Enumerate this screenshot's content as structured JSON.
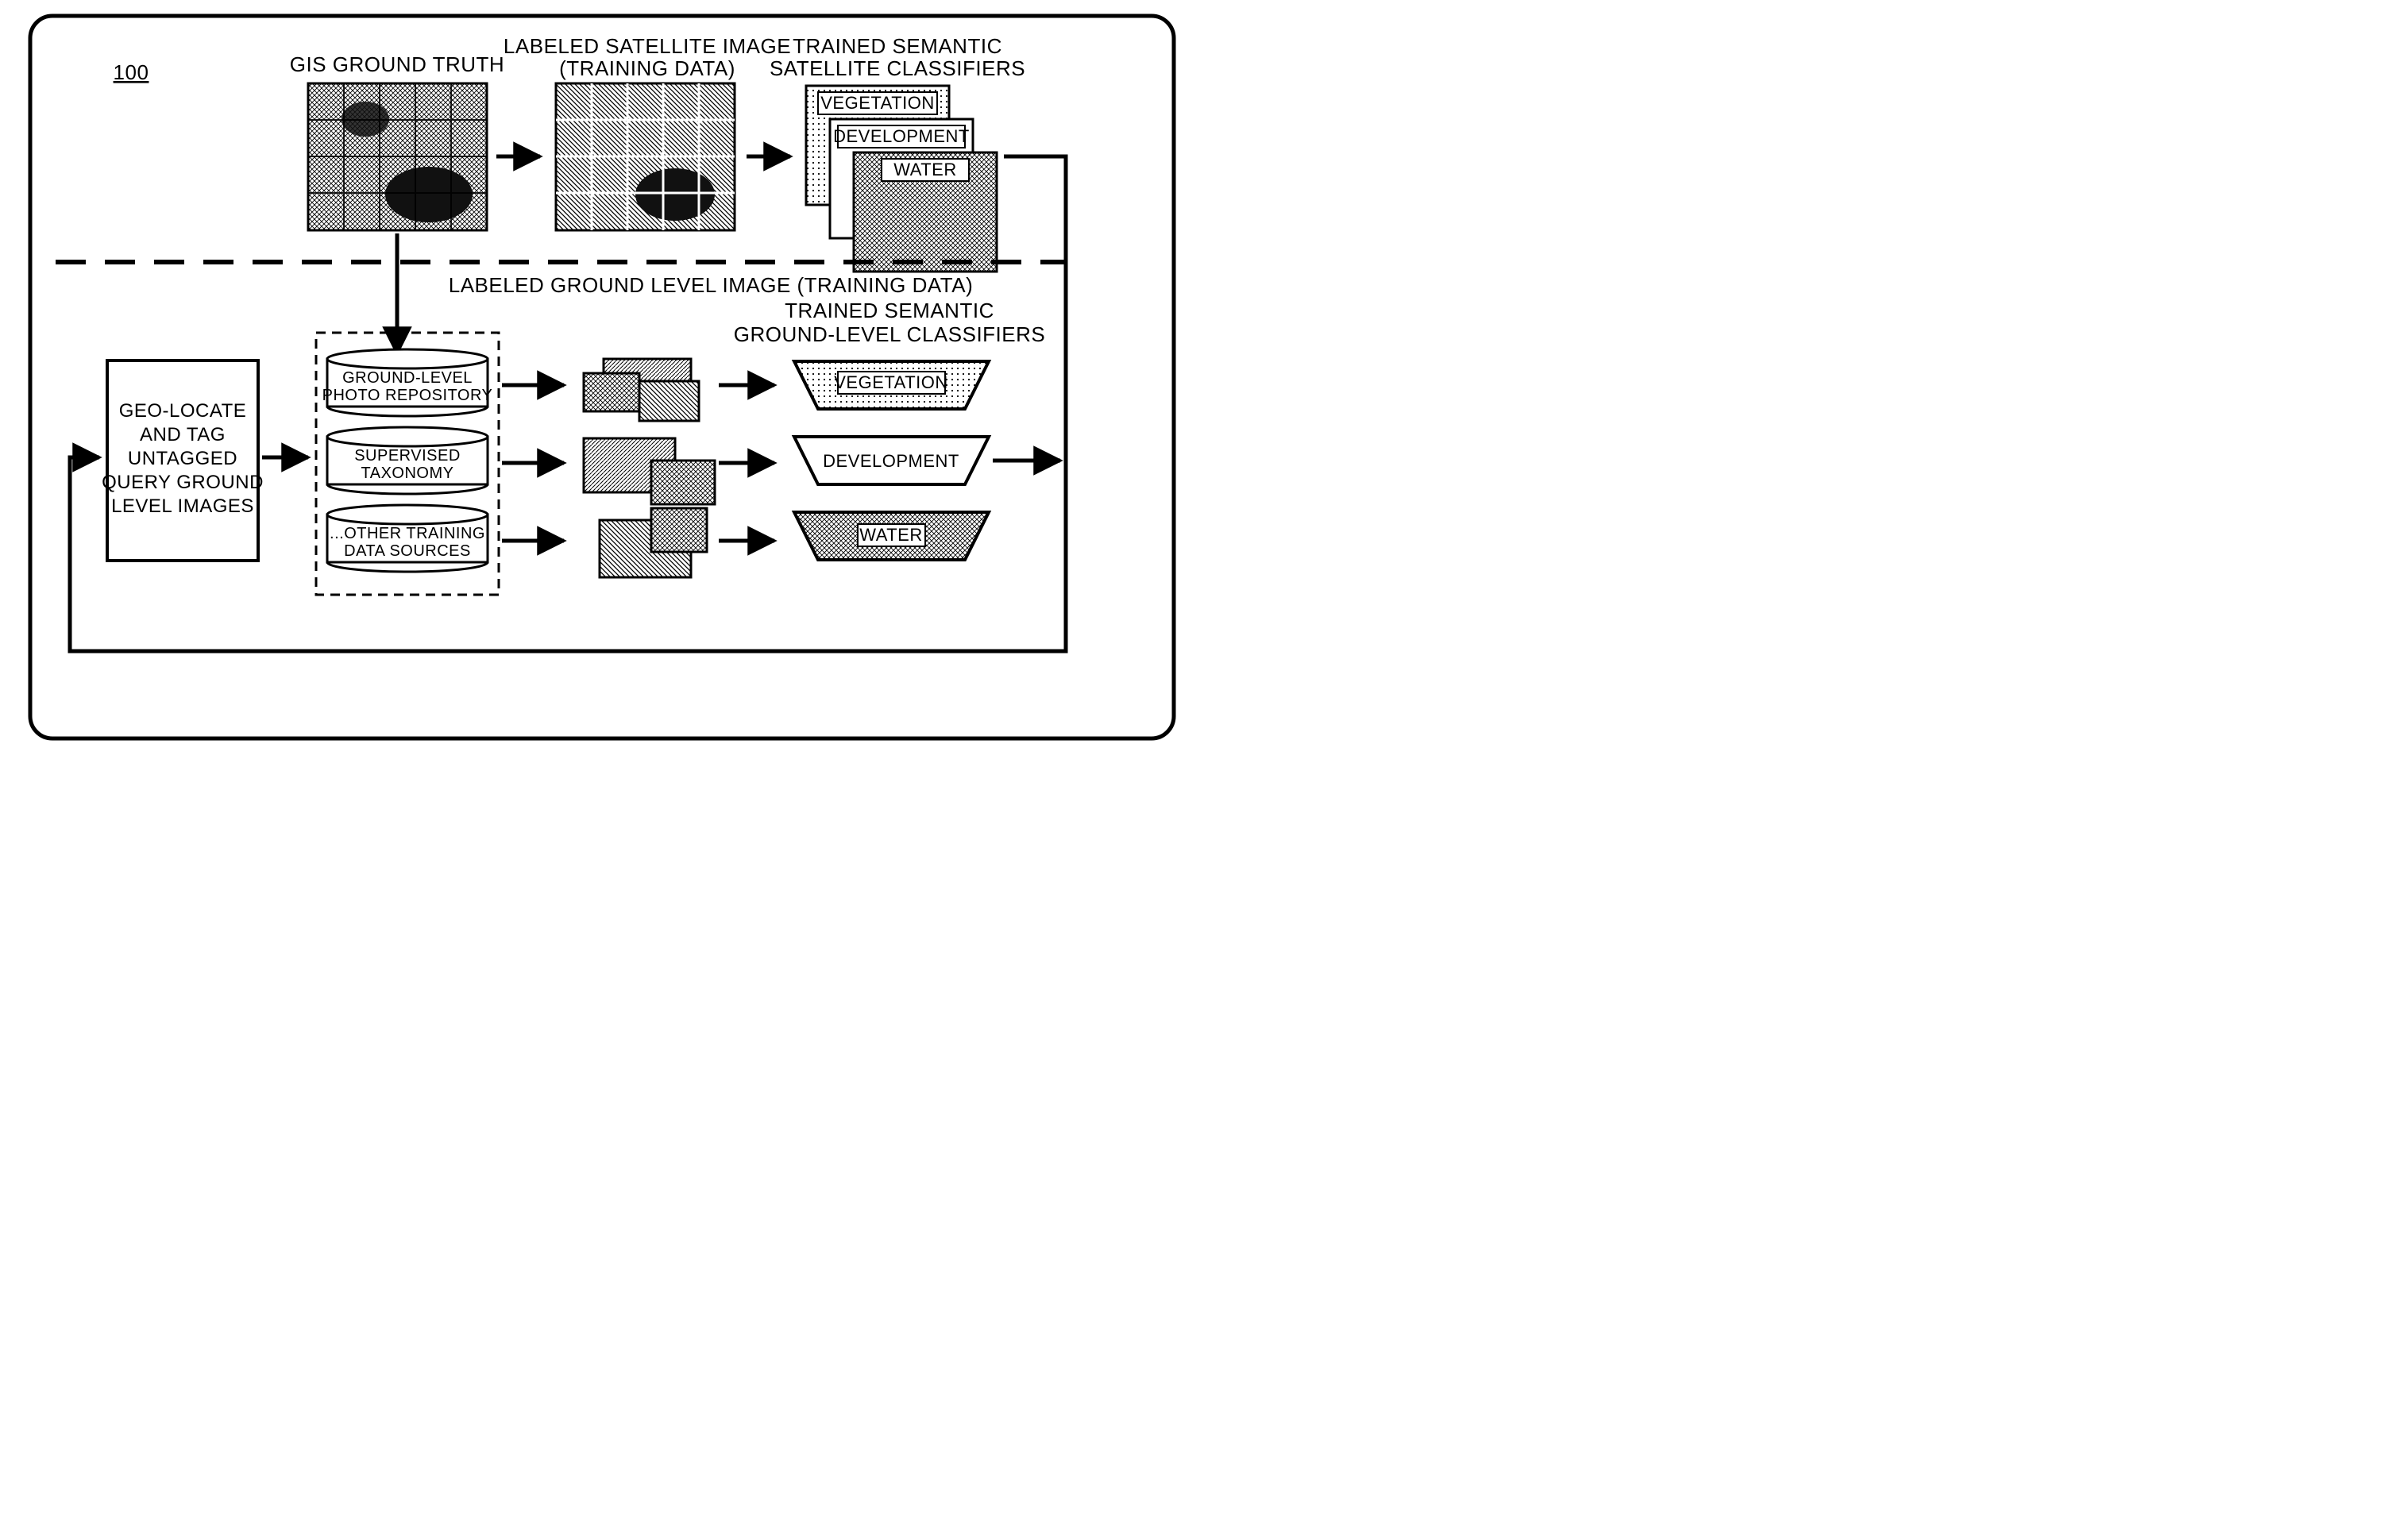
{
  "figure_number": "100",
  "top_labels": {
    "gis": "GIS GROUND TRUTH",
    "labeled_sat_l1": "LABELED SATELLITE IMAGE",
    "labeled_sat_l2": "(TRAINING DATA)",
    "trained_sat_l1": "TRAINED SEMANTIC",
    "trained_sat_l2": "SATELLITE CLASSIFIERS"
  },
  "sat_classes": {
    "vegetation": "VEGETATION",
    "development": "DEVELOPMENT",
    "water": "WATER"
  },
  "mid_section_label": "LABELED GROUND LEVEL IMAGE (TRAINING DATA)",
  "left_block": {
    "l1": "GEO-LOCATE",
    "l2": "AND TAG",
    "l3": "UNTAGGED",
    "l4": "QUERY GROUND",
    "l5": "LEVEL IMAGES"
  },
  "cylinders": {
    "c1_l1": "GROUND-LEVEL",
    "c1_l2": "PHOTO REPOSITORY",
    "c2_l1": "SUPERVISED",
    "c2_l2": "TAXONOMY",
    "c3_l1": "...OTHER TRAINING",
    "c3_l2": "DATA SOURCES"
  },
  "ground_header": {
    "l1": "TRAINED SEMANTIC",
    "l2": "GROUND-LEVEL CLASSIFIERS"
  },
  "ground_classes": {
    "vegetation": "VEGETATION",
    "development": "DEVELOPMENT",
    "water": "WATER"
  }
}
